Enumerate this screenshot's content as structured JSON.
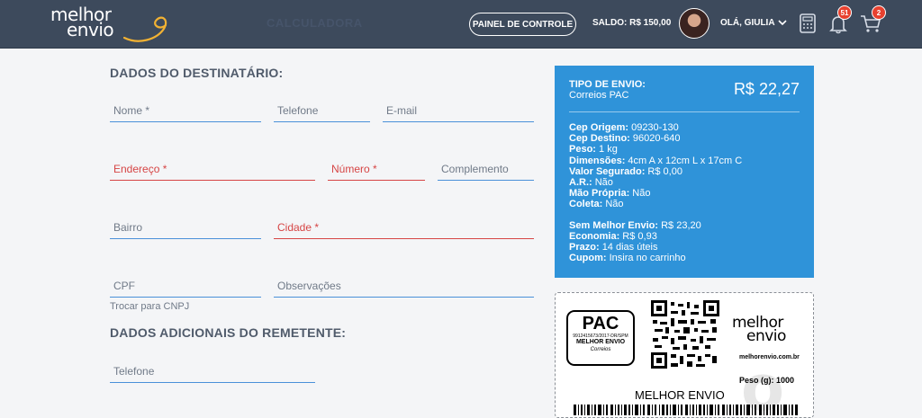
{
  "header": {
    "logo_line1": "melhor",
    "logo_line2": "envio",
    "ghost_title": "CALCULADORA",
    "panel_button": "PAINEL DE CONTROLE",
    "saldo": "SALDO: R$ 150,00",
    "greeting": "OLÁ, GIULIA",
    "notifications_count": "51",
    "cart_count": "2"
  },
  "recipient": {
    "title": "DADOS DO DESTINATÁRIO:",
    "fields": {
      "nome": "Nome *",
      "telefone": "Telefone",
      "email": "E-mail",
      "endereco": "Endereço *",
      "numero": "Número *",
      "complemento": "Complemento",
      "bairro": "Bairro",
      "cidade": "Cidade *",
      "cpf": "CPF",
      "observacoes": "Observações"
    },
    "switch_cnpj": "Trocar para CNPJ"
  },
  "sender": {
    "title": "DADOS ADICIONAIS DO REMETENTE:",
    "telefone": "Telefone"
  },
  "summary": {
    "type_label": "TIPO DE ENVIO:",
    "type_value": "Correios PAC",
    "price": "R$ 22,27",
    "rows1": [
      {
        "k": "Cep Origem:",
        "v": "09230-130"
      },
      {
        "k": "Cep Destino:",
        "v": "96020-640"
      },
      {
        "k": "Peso:",
        "v": "1 kg"
      },
      {
        "k": "Dimensões:",
        "v": "4cm A x 12cm L x 17cm C"
      },
      {
        "k": "Valor Segurado:",
        "v": "R$ 0,00"
      },
      {
        "k": "A.R.:",
        "v": "Não"
      },
      {
        "k": "Mão Própria:",
        "v": "Não"
      },
      {
        "k": "Coleta:",
        "v": "Não"
      }
    ],
    "rows2": [
      {
        "k": "Sem Melhor Envio:",
        "v": "R$ 23,20"
      },
      {
        "k": "Economia:",
        "v": "R$ 0,93"
      },
      {
        "k": "Prazo:",
        "v": "14 dias úteis"
      },
      {
        "k": "Cupom:",
        "v": "Insira no carrinho"
      }
    ]
  },
  "label": {
    "pac": "PAC",
    "pac_code": "9912415673/2017-DR/SPM",
    "pac_me": "MELHOR ENVIO",
    "pac_correios": "Correios",
    "logo_line1": "melhor",
    "logo_line2": "envio",
    "site": "melhorenvio.com.br",
    "peso": "Peso (g): 1000",
    "name": "MELHOR ENVIO"
  },
  "colors": {
    "topbar": "#3d4a5c",
    "accent_blue": "#2f93d9",
    "required_red": "#d64545",
    "badge_red": "#e8412f"
  }
}
